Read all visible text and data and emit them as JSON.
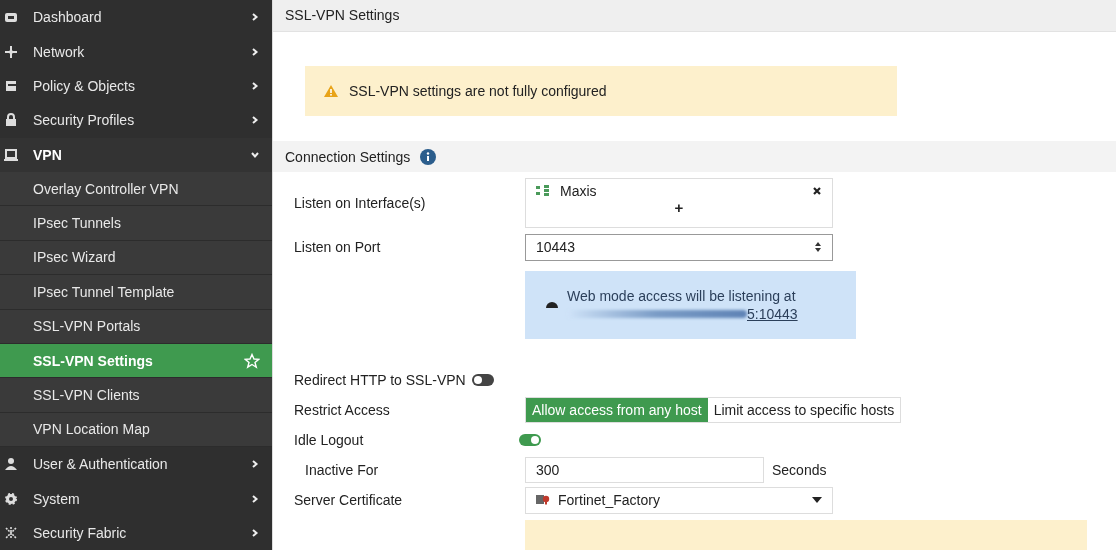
{
  "sidebar": {
    "items": [
      {
        "label": "Dashboard",
        "kind": "section",
        "expanded": false
      },
      {
        "label": "Network",
        "kind": "section",
        "expanded": false
      },
      {
        "label": "Policy & Objects",
        "kind": "section",
        "expanded": false
      },
      {
        "label": "Security Profiles",
        "kind": "section",
        "expanded": false
      },
      {
        "label": "VPN",
        "kind": "section",
        "expanded": true
      },
      {
        "label": "Overlay Controller VPN",
        "kind": "sub",
        "selected": false
      },
      {
        "label": "IPsec Tunnels",
        "kind": "sub",
        "selected": false
      },
      {
        "label": "IPsec Wizard",
        "kind": "sub",
        "selected": false
      },
      {
        "label": "IPsec Tunnel Template",
        "kind": "sub",
        "selected": false
      },
      {
        "label": "SSL-VPN Portals",
        "kind": "sub",
        "selected": false
      },
      {
        "label": "SSL-VPN Settings",
        "kind": "sub",
        "selected": true
      },
      {
        "label": "SSL-VPN Clients",
        "kind": "sub",
        "selected": false
      },
      {
        "label": "VPN Location Map",
        "kind": "sub",
        "selected": false
      },
      {
        "label": "User & Authentication",
        "kind": "section",
        "expanded": false
      },
      {
        "label": "System",
        "kind": "section",
        "expanded": false
      },
      {
        "label": "Security Fabric",
        "kind": "section",
        "expanded": false
      }
    ]
  },
  "page_title": "SSL-VPN Settings",
  "warning": "SSL-VPN settings are not fully configured",
  "section_title": "Connection Settings",
  "form": {
    "interfaces": {
      "label": "Listen on Interface(s)",
      "value": "Maxis",
      "add": "+"
    },
    "port": {
      "label": "Listen on Port",
      "value": "10443"
    },
    "info": {
      "text": "Web mode access will be listening at",
      "link": "5:10443"
    },
    "redirect": {
      "label": "Redirect HTTP to SSL-VPN",
      "on": false
    },
    "restrict": {
      "label": "Restrict Access",
      "options": [
        {
          "label": "Allow access from any host",
          "selected": true
        },
        {
          "label": "Limit access to specific hosts",
          "selected": false
        }
      ]
    },
    "idle": {
      "label": "Idle Logout",
      "on": true
    },
    "inactive": {
      "label": "Inactive For",
      "value": "300",
      "unit": "Seconds"
    },
    "certificate": {
      "label": "Server Certificate",
      "value": "Fortinet_Factory"
    }
  }
}
